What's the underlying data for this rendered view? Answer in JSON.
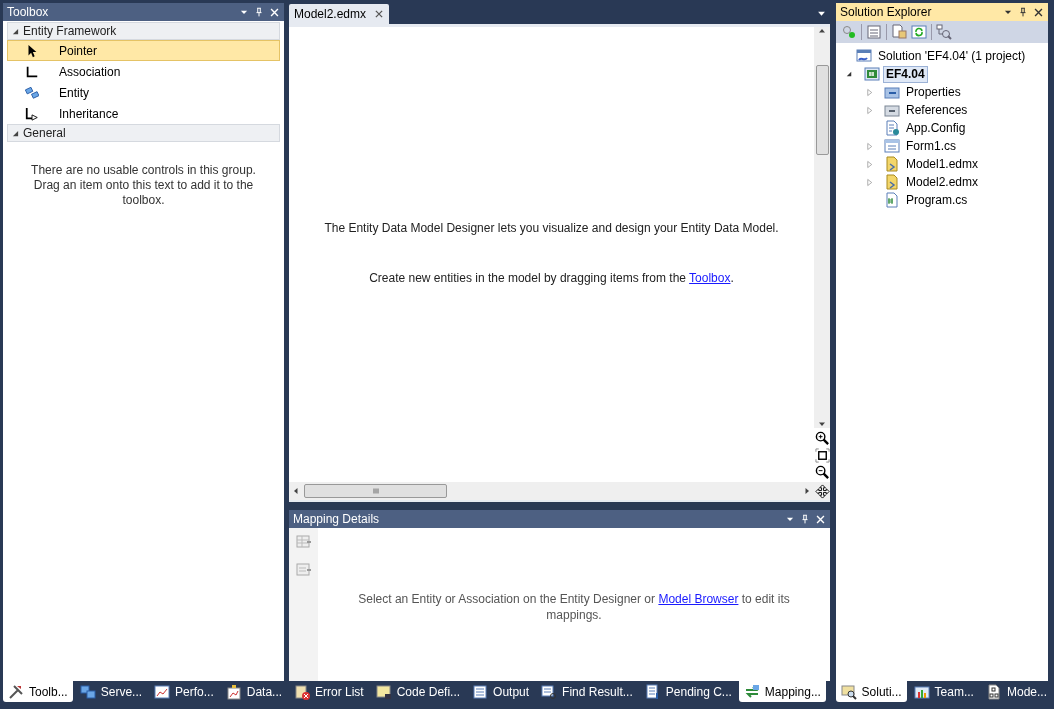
{
  "toolbox": {
    "title": "Toolbox",
    "active": false,
    "groups": [
      {
        "label": "Entity Framework",
        "expanded": true,
        "items": [
          {
            "label": "Pointer",
            "kind": "pointer",
            "selected": true
          },
          {
            "label": "Association",
            "kind": "association",
            "selected": false
          },
          {
            "label": "Entity",
            "kind": "entity",
            "selected": false
          },
          {
            "label": "Inheritance",
            "kind": "inheritance",
            "selected": false
          }
        ]
      },
      {
        "label": "General",
        "expanded": true,
        "empty_text": "There are no usable controls in this group. Drag an item onto this text to add it to the toolbox."
      }
    ]
  },
  "editor": {
    "tabs": [
      {
        "label": "Model2.edmx",
        "selected": true
      }
    ],
    "message": "The Entity Data Model Designer lets you visualize and design your Entity Data Model.",
    "hint_before": "Create new entities in the model by dragging items from the ",
    "hint_link": "Toolbox",
    "hint_after": "."
  },
  "mapping_details": {
    "title": "Mapping Details",
    "active": false,
    "text_before": "Select an Entity or Association on the Entity Designer or ",
    "link": "Model Browser",
    "text_after": " to edit its mappings."
  },
  "solution_explorer": {
    "title": "Solution Explorer",
    "active": true,
    "tree": [
      {
        "label": "Solution 'EF4.04' (1 project)",
        "kind": "solution",
        "children": [
          {
            "label": "EF4.04",
            "kind": "project",
            "expanded": true,
            "selected": true,
            "children": [
              {
                "label": "Properties",
                "kind": "properties",
                "expanded": false,
                "selected": false
              },
              {
                "label": "References",
                "kind": "references",
                "expanded": false,
                "selected": false
              },
              {
                "label": "App.Config",
                "kind": "config",
                "selected": false
              },
              {
                "label": "Form1.cs",
                "kind": "form",
                "expanded": false,
                "selected": false
              },
              {
                "label": "Model1.edmx",
                "kind": "edmx",
                "expanded": false,
                "selected": false
              },
              {
                "label": "Model2.edmx",
                "kind": "edmx",
                "expanded": false,
                "selected": false
              },
              {
                "label": "Program.cs",
                "kind": "csharp",
                "selected": false
              }
            ]
          }
        ]
      }
    ]
  },
  "bottom_tabs": {
    "left": [
      {
        "label": "Toolb...",
        "kind": "toolbox",
        "selected": true
      },
      {
        "label": "Serve...",
        "kind": "server",
        "selected": false
      },
      {
        "label": "Perfo...",
        "kind": "chart",
        "selected": false
      },
      {
        "label": "Data...",
        "kind": "data",
        "selected": false
      }
    ],
    "center": [
      {
        "label": "Error List",
        "kind": "error",
        "selected": false
      },
      {
        "label": "Code Defi...",
        "kind": "code",
        "selected": false
      },
      {
        "label": "Output",
        "kind": "output",
        "selected": false
      },
      {
        "label": "Find Result...",
        "kind": "find",
        "selected": false
      },
      {
        "label": "Pending C...",
        "kind": "pending",
        "selected": false
      },
      {
        "label": "Mapping...",
        "kind": "mapping",
        "selected": true
      }
    ],
    "right": [
      {
        "label": "Soluti...",
        "kind": "solution",
        "selected": true
      },
      {
        "label": "Team...",
        "kind": "team",
        "selected": false
      },
      {
        "label": "Mode...",
        "kind": "model",
        "selected": false
      }
    ]
  }
}
